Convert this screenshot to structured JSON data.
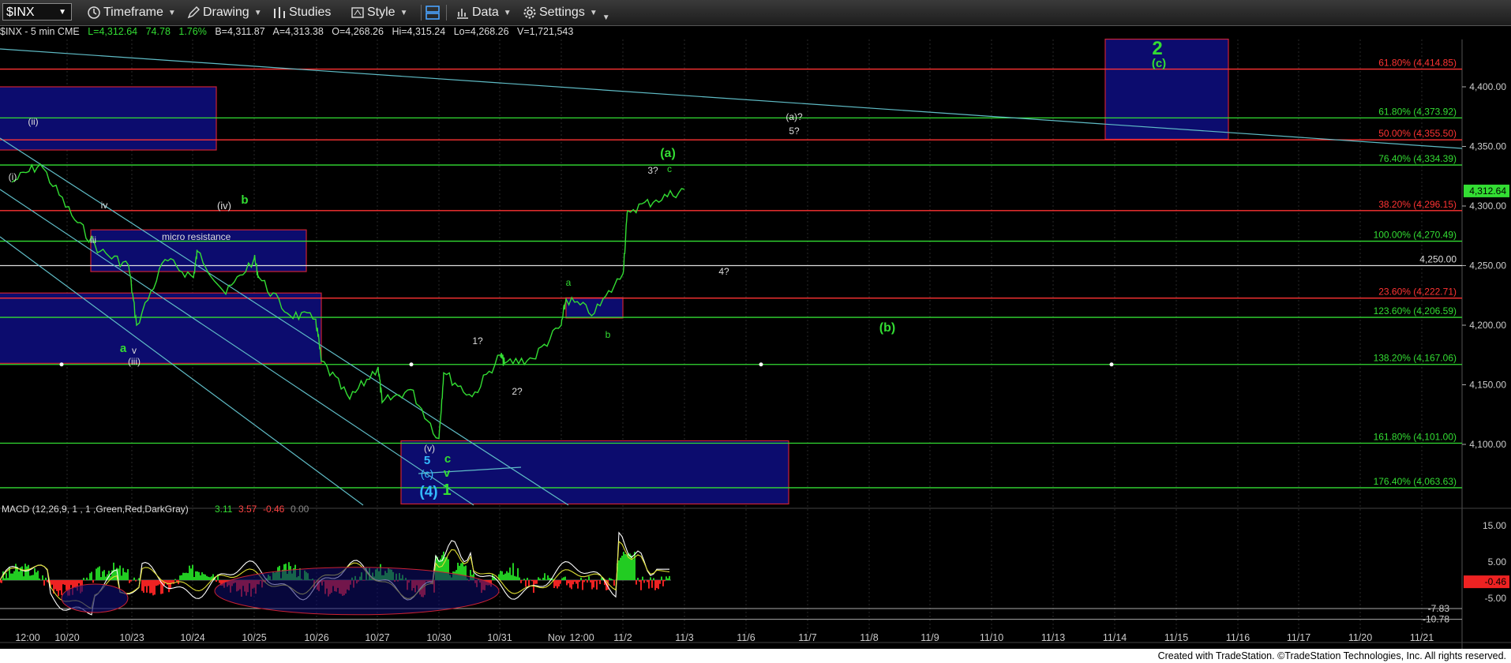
{
  "toolbar": {
    "symbol": "$INX",
    "timeframe": "Timeframe",
    "drawing": "Drawing",
    "studies": "Studies",
    "style": "Style",
    "data": "Data",
    "settings": "Settings"
  },
  "info": {
    "symbol_line": "$INX - 5 min  CME",
    "last": "L=4,312.64",
    "change": "74.78",
    "change_pct": "1.76%",
    "bid": "B=4,311.87",
    "ask": "A=4,313.38",
    "open": "O=4,268.26",
    "high": "Hi=4,315.24",
    "low": "Lo=4,268.26",
    "volume": "V=1,721,543"
  },
  "chart_data": {
    "type": "line",
    "title": "$INX - 5 min",
    "y_axis": {
      "ticks": [
        4100,
        4150,
        4200,
        4250,
        4300,
        4350,
        4400
      ],
      "tick_labels": [
        "4,100.00",
        "4,150.00",
        "4,200.00",
        "4,250.00",
        "4,300.00",
        "4,350.00",
        "4,400.00"
      ],
      "range": [
        4050,
        4430
      ]
    },
    "x_tick_labels": [
      "12:00",
      "10/20",
      "10/23",
      "10/24",
      "10/25",
      "10/26",
      "10/27",
      "10/30",
      "10/31",
      "Nov",
      "12:00",
      "11/2",
      "11/3",
      "11/6",
      "11/7",
      "11/8",
      "11/9",
      "11/10",
      "11/13",
      "11/14",
      "11/15",
      "11/16",
      "11/17",
      "11/20",
      "11/21"
    ],
    "last_price_label": "4,312.64",
    "series": [
      {
        "name": "$INX",
        "color": "#33dd33",
        "x": [
          "10/19 12:00",
          "10/19 15:00",
          "10/20 10:00",
          "10/20 13:00",
          "10/20 16:00",
          "10/23 10:00",
          "10/23 13:00",
          "10/23 16:00",
          "10/24 10:00",
          "10/24 13:00",
          "10/24 16:00",
          "10/25 10:00",
          "10/25 13:00",
          "10/25 16:00",
          "10/26 10:00",
          "10/26 13:00",
          "10/26 16:00",
          "10/27 10:00",
          "10/27 13:00",
          "10/27 16:00",
          "10/30 10:00",
          "10/30 13:00",
          "10/30 16:00",
          "10/31 10:00",
          "10/31 13:00",
          "10/31 16:00",
          "11/1 10:00",
          "11/1 13:00",
          "11/1 16:00",
          "11/2 10:00",
          "11/2 13:00",
          "11/2 16:00"
        ],
        "y": [
          4320,
          4335,
          4292,
          4262,
          4250,
          4200,
          4255,
          4240,
          4262,
          4226,
          4256,
          4240,
          4210,
          4205,
          4170,
          4138,
          4165,
          4135,
          4146,
          4105,
          4160,
          4140,
          4175,
          4168,
          4172,
          4200,
          4222,
          4210,
          4243,
          4296,
          4305,
          4314
        ]
      }
    ],
    "horizontal_levels": [
      {
        "label": "61.80% (4,414.85)",
        "value": 4414.85,
        "color": "#ff3333"
      },
      {
        "label": "61.80% (4,373.92)",
        "value": 4373.92,
        "color": "#33dd33"
      },
      {
        "label": "50.00% (4,355.50)",
        "value": 4355.5,
        "color": "#ff3333"
      },
      {
        "label": "76.40% (4,334.39)",
        "value": 4334.39,
        "color": "#33dd33"
      },
      {
        "label": "38.20% (4,296.15)",
        "value": 4296.15,
        "color": "#ff3333"
      },
      {
        "label": "100.00% (4,270.49)",
        "value": 4270.49,
        "color": "#33dd33"
      },
      {
        "label": "4,250.00",
        "value": 4250.0,
        "color": "#dddddd"
      },
      {
        "label": "23.60% (4,222.71)",
        "value": 4222.71,
        "color": "#ff3333"
      },
      {
        "label": "123.60% (4,206.59)",
        "value": 4206.59,
        "color": "#33dd33"
      },
      {
        "label": "138.20% (4,167.06)",
        "value": 4167.06,
        "color": "#33dd33"
      },
      {
        "label": "161.80% (4,101.00)",
        "value": 4101.0,
        "color": "#33dd33"
      },
      {
        "label": "176.40% (4,063.63)",
        "value": 4063.63,
        "color": "#33dd33"
      }
    ],
    "boxes": [
      {
        "from": "10/18",
        "to": "10/24 12:00",
        "top": 4400,
        "bottom": 4347
      },
      {
        "from": "10/20 12:00",
        "to": "10/25 15:00",
        "top": 4280,
        "bottom": 4245,
        "label": "micro resistance"
      },
      {
        "from": "10/18",
        "to": "10/26 10:00",
        "top": 4227,
        "bottom": 4168
      },
      {
        "from": "10/27 12:00",
        "to": "11/6 14:00",
        "top": 4103,
        "bottom": 4050
      },
      {
        "from": "11/1 10:00",
        "to": "11/1 16:00",
        "top": 4223,
        "bottom": 4206
      },
      {
        "from": "11/13 15:00",
        "to": "11/15 15:00",
        "top": 4440,
        "bottom": 4356
      }
    ],
    "annotations": [
      {
        "text": "(ii)",
        "color": "#dddddd"
      },
      {
        "text": "(i)",
        "color": "#dddddd"
      },
      {
        "text": "iv",
        "color": "#dddddd"
      },
      {
        "text": "iii",
        "color": "#dddddd"
      },
      {
        "text": "(iv)",
        "color": "#dddddd"
      },
      {
        "text": "b",
        "color": "#33dd33"
      },
      {
        "text": "a",
        "color": "#33dd33"
      },
      {
        "text": "v",
        "color": "#dddddd"
      },
      {
        "text": "(iii)",
        "color": "#dddddd"
      },
      {
        "text": "(v)",
        "color": "#dddddd"
      },
      {
        "text": "5",
        "color": "#33bbff"
      },
      {
        "text": "(c)",
        "color": "#33bbff"
      },
      {
        "text": "(4)",
        "color": "#33bbff"
      },
      {
        "text": "c",
        "color": "#33dd33"
      },
      {
        "text": "v",
        "color": "#33dd33"
      },
      {
        "text": "1",
        "color": "#33dd33"
      },
      {
        "text": "1?",
        "color": "#dddddd"
      },
      {
        "text": "2?",
        "color": "#dddddd"
      },
      {
        "text": "a",
        "color": "#33dd33"
      },
      {
        "text": "b",
        "color": "#33dd33"
      },
      {
        "text": "3?",
        "color": "#dddddd"
      },
      {
        "text": "c",
        "color": "#33dd33"
      },
      {
        "text": "(a)",
        "color": "#33dd33"
      },
      {
        "text": "4?",
        "color": "#dddddd"
      },
      {
        "text": "(a)?",
        "color": "#dddddd"
      },
      {
        "text": "5?",
        "color": "#dddddd"
      },
      {
        "text": "(b)",
        "color": "#33dd33"
      },
      {
        "text": "2",
        "color": "#33dd33"
      },
      {
        "text": "(c)",
        "color": "#33dd33"
      }
    ]
  },
  "macd": {
    "label": "MACD (12,26,9, 1 , 1 ,Green,Red,DarkGray)",
    "v1": "3.11",
    "v2": "3.57",
    "v3": "-0.46",
    "v4": "0.00",
    "ticks": [
      "15.00",
      "5.00",
      "-5.00"
    ],
    "level_labels": [
      "-7.83",
      "-10.78"
    ],
    "current_label": "-0.46"
  },
  "credit": "Created with TradeStation. ©TradeStation Technologies, Inc. All rights reserved."
}
